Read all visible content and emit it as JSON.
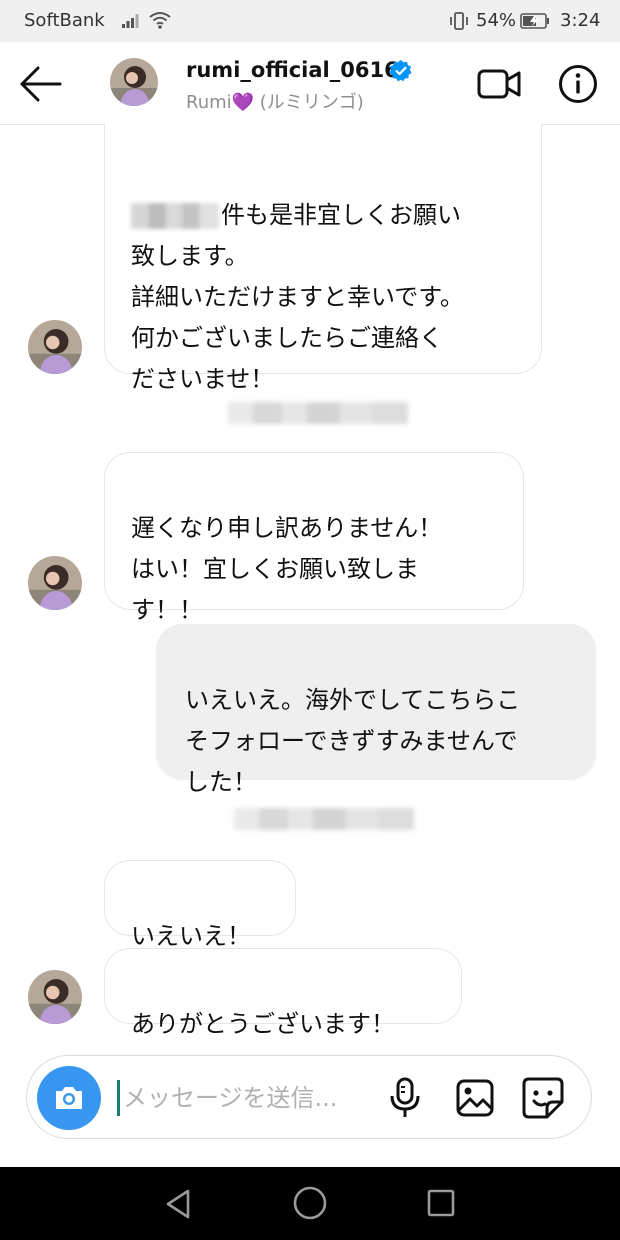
{
  "status_bar": {
    "carrier": "SoftBank",
    "battery": "54%",
    "time": "3:24",
    "icons": [
      "signal-icon",
      "wifi-icon",
      "vibrate-icon",
      "battery-icon"
    ]
  },
  "header": {
    "username": "rumi_official_0616",
    "subtitle": "Rumi💜 (ルミリンゴ)",
    "icons": [
      "back-arrow-icon",
      "verified-badge-icon",
      "video-call-icon",
      "info-icon"
    ]
  },
  "messages": [
    {
      "from": "them",
      "text": "件も是非宜しくお願い\n致します。\n詳細いただけますと幸いです。\n何かございましたらご連絡く\nださいませ！"
    },
    {
      "from": "them",
      "text": "遅くなり申し訳ありません！\nはい！宜しくお願い致しま\nす！！"
    },
    {
      "from": "me",
      "text": "いえいえ。海外でしてこちらこ\nそフォローできずすみませんで\nした！"
    },
    {
      "from": "them",
      "text": "いえいえ！"
    },
    {
      "from": "them",
      "text": "ありがとうございます！"
    }
  ],
  "composer": {
    "placeholder": "メッセージを送信...",
    "value": "",
    "icons": [
      "camera-icon",
      "microphone-icon",
      "gallery-icon",
      "sticker-icon"
    ]
  },
  "colors": {
    "accent_blue": "#3797f0",
    "verified_blue": "#0095f6",
    "outgoing_bubble": "#efefef",
    "status_bar_bg": "#f0f0f0"
  }
}
